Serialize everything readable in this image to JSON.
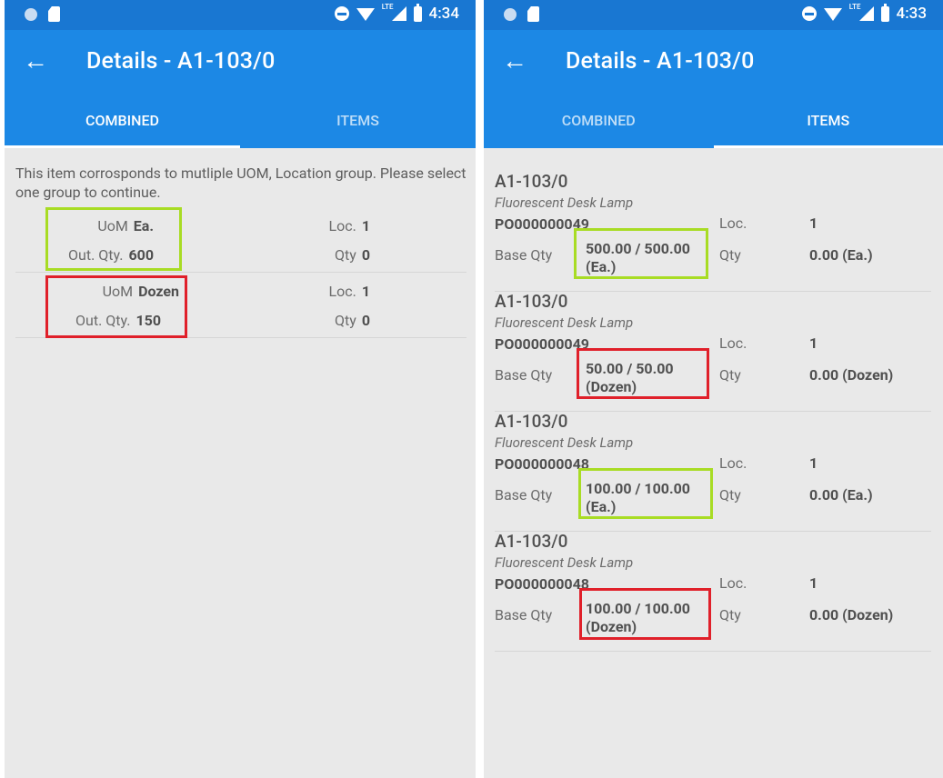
{
  "left_screen": {
    "status": {
      "time": "4:34",
      "network": "LTE"
    },
    "title": "Details - A1-103/0",
    "tabs": [
      "COMBINED",
      "ITEMS"
    ],
    "active_tab": 0,
    "notice": "This item corrosponds to mutliple UOM, Location group. Please select one group to continue.",
    "groups": [
      {
        "uom_label": "UoM",
        "uom": "Ea.",
        "out_qty_label": "Out. Qty.",
        "out_qty": "600",
        "loc_label": "Loc.",
        "loc": "1",
        "qty_label": "Qty",
        "qty": "0",
        "highlight": "green"
      },
      {
        "uom_label": "UoM",
        "uom": "Dozen",
        "out_qty_label": "Out. Qty.",
        "out_qty": "150",
        "loc_label": "Loc.",
        "loc": "1",
        "qty_label": "Qty",
        "qty": "0",
        "highlight": "red"
      }
    ]
  },
  "right_screen": {
    "status": {
      "time": "4:33",
      "network": "LTE"
    },
    "title": "Details - A1-103/0",
    "tabs": [
      "COMBINED",
      "ITEMS"
    ],
    "active_tab": 1,
    "items": [
      {
        "title": "A1-103/0",
        "description": "Fluorescent Desk Lamp",
        "po": "PO000000049",
        "loc_label": "Loc.",
        "loc": "1",
        "base_qty_label": "Base Qty",
        "base_qty_line1": "500.00 / 500.00",
        "base_qty_line2": "(Ea.)",
        "qty_label": "Qty",
        "qty": "0.00 (Ea.)",
        "highlight": "green"
      },
      {
        "title": "A1-103/0",
        "description": "Fluorescent Desk Lamp",
        "po": "PO000000049",
        "loc_label": "Loc.",
        "loc": "1",
        "base_qty_label": "Base Qty",
        "base_qty_line1": "50.00 / 50.00",
        "base_qty_line2": "(Dozen)",
        "qty_label": "Qty",
        "qty": "0.00 (Dozen)",
        "highlight": "red"
      },
      {
        "title": "A1-103/0",
        "description": "Fluorescent Desk Lamp",
        "po": "PO000000048",
        "loc_label": "Loc.",
        "loc": "1",
        "base_qty_label": "Base Qty",
        "base_qty_line1": "100.00 / 100.00",
        "base_qty_line2": "(Ea.)",
        "qty_label": "Qty",
        "qty": "0.00 (Ea.)",
        "highlight": "green"
      },
      {
        "title": "A1-103/0",
        "description": "Fluorescent Desk Lamp",
        "po": "PO000000048",
        "loc_label": "Loc.",
        "loc": "1",
        "base_qty_label": "Base Qty",
        "base_qty_line1": "100.00 / 100.00",
        "base_qty_line2": "(Dozen)",
        "qty_label": "Qty",
        "qty": "0.00 (Dozen)",
        "highlight": "red"
      }
    ]
  },
  "icons": {
    "back": "arrow-left-icon",
    "status": [
      "circle-icon",
      "sd-card-icon",
      "do-not-disturb-icon",
      "wifi-icon",
      "signal-icon",
      "battery-charging-icon"
    ]
  },
  "colors": {
    "status_bar": "#1977d2",
    "app_bar": "#1c88e5",
    "background": "#e9e9e9",
    "highlight_green": "#a8dc24",
    "highlight_red": "#e0202a"
  }
}
